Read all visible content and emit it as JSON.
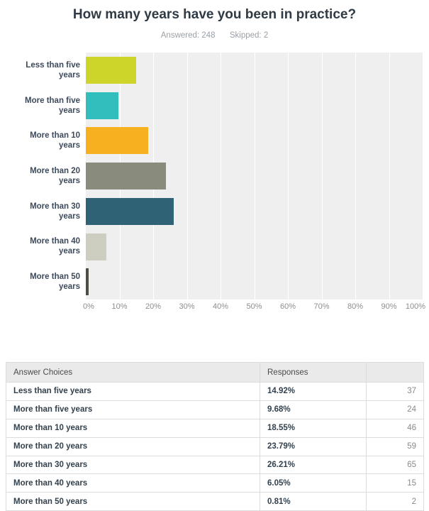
{
  "header": {
    "title": "How many years have you been in practice?",
    "answered_label": "Answered: 248",
    "skipped_label": "Skipped: 2"
  },
  "table": {
    "headers": {
      "choices": "Answer Choices",
      "responses": "Responses"
    },
    "rows": [
      {
        "choice": "Less than five years",
        "percent": "14.92%",
        "count": "37"
      },
      {
        "choice": "More than five years",
        "percent": "9.68%",
        "count": "24"
      },
      {
        "choice": "More than 10 years",
        "percent": "18.55%",
        "count": "46"
      },
      {
        "choice": "More than 20 years",
        "percent": "23.79%",
        "count": "59"
      },
      {
        "choice": "More than 30 years",
        "percent": "26.21%",
        "count": "65"
      },
      {
        "choice": "More than 40 years",
        "percent": "6.05%",
        "count": "15"
      },
      {
        "choice": "More than 50 years",
        "percent": "0.81%",
        "count": "2"
      }
    ]
  },
  "chart_data": {
    "type": "bar",
    "orientation": "horizontal",
    "title": "How many years have you been in practice?",
    "subtitle": "Answered: 248    Skipped: 2",
    "xlabel": "",
    "ylabel": "",
    "xlim": [
      0,
      100
    ],
    "grid": true,
    "legend": false,
    "tick_labels": [
      "0%",
      "10%",
      "20%",
      "30%",
      "40%",
      "50%",
      "60%",
      "70%",
      "80%",
      "90%",
      "100%"
    ],
    "tick_values": [
      0,
      10,
      20,
      30,
      40,
      50,
      60,
      70,
      80,
      90,
      100
    ],
    "categories": [
      "Less than five years",
      "More than five years",
      "More than 10 years",
      "More than 20 years",
      "More than 30 years",
      "More than 40 years",
      "More than 50 years"
    ],
    "category_lines": [
      [
        "Less than five",
        "years"
      ],
      [
        "More than five",
        "years"
      ],
      [
        "More than 10",
        "years"
      ],
      [
        "More than 20",
        "years"
      ],
      [
        "More than 30",
        "years"
      ],
      [
        "More than 40",
        "years"
      ],
      [
        "More than 50",
        "years"
      ]
    ],
    "values": [
      14.92,
      9.68,
      18.55,
      23.79,
      26.21,
      6.05,
      0.81
    ],
    "counts": [
      37,
      24,
      46,
      59,
      65,
      15,
      2
    ],
    "colors": [
      "#cdd42a",
      "#31bebc",
      "#f7b020",
      "#898c7c",
      "#2f6274",
      "#cdcdc0",
      "#4e4f42"
    ],
    "plot_background": "#efefef",
    "answered": 248,
    "skipped": 2
  }
}
